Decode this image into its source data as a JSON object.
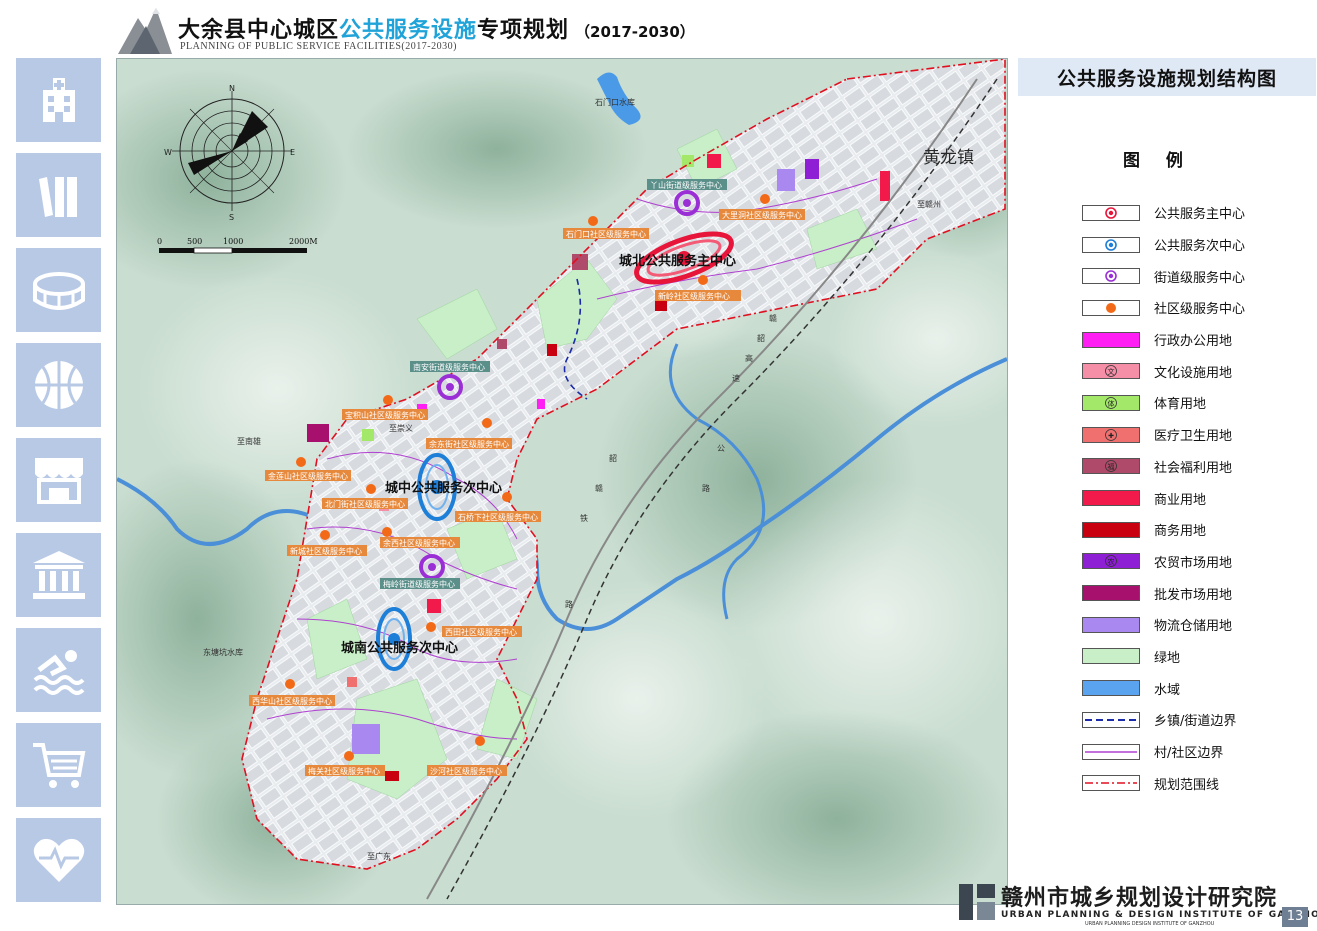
{
  "header": {
    "title_part1": "大余县中心城区",
    "title_part2": "公共服务设施",
    "title_part3": "专项规划",
    "years": "（2017-2030）",
    "subtitle": "PLANNING OF PUBLIC SERVICE FACILITIES(2017-2030)"
  },
  "sidebar": {
    "items": [
      {
        "icon": "hospital-icon"
      },
      {
        "icon": "books-icon"
      },
      {
        "icon": "stadium-icon"
      },
      {
        "icon": "basketball-icon"
      },
      {
        "icon": "shop-icon"
      },
      {
        "icon": "museum-icon"
      },
      {
        "icon": "swimming-icon"
      },
      {
        "icon": "cart-icon"
      },
      {
        "icon": "health-heart-icon"
      }
    ]
  },
  "map": {
    "compass": {
      "n": "N",
      "s": "S",
      "e": "E",
      "w": "W"
    },
    "scale": {
      "t0": "0",
      "t1": "500",
      "t2": "1000",
      "t3": "2000M"
    },
    "town_label": "黄龙镇",
    "centers": {
      "main": "城北公共服务主中心",
      "central": "城中公共服务次中心",
      "south": "城南公共服务次中心"
    },
    "labels": {
      "l1": "丫山街道级服务中心",
      "l2": "大里洞社区级服务中心",
      "l3": "石门口社区级服务中心",
      "l4": "新岭社区级服务中心",
      "l5": "南安街道级服务中心",
      "l6": "宝积山社区级服务中心",
      "l7": "余东街社区级服务中心",
      "l8": "金莲山社区级服务中心",
      "l9": "北门街社区级服务中心",
      "l10": "石桥下社区级服务中心",
      "l11": "余西社区级服务中心",
      "l12": "新城社区级服务中心",
      "l13": "梅岭街道级服务中心",
      "l14": "西田社区级服务中心",
      "l15": "西华山社区级服务中心",
      "l16": "梅关社区级服务中心",
      "l17": "沙河社区级服务中心"
    },
    "places": {
      "reservoir_n": "石门口水库",
      "reservoir_w": "东塘坑水库",
      "road_1": "至崇义",
      "road_2": "至赣州",
      "road_3": "至南雄",
      "road_4": "至广东"
    },
    "rail_chars": [
      "赣",
      "韶",
      "铁",
      "路"
    ],
    "highway_chars": [
      "赣",
      "韶",
      "高",
      "速",
      "公",
      "路"
    ]
  },
  "legend": {
    "title": "公共服务设施规划结构图",
    "heading": "图 例",
    "items": [
      {
        "label": "公共服务主中心",
        "type": "ring",
        "color": "#e8153a"
      },
      {
        "label": "公共服务次中心",
        "type": "ring",
        "color": "#1e7fd8"
      },
      {
        "label": "街道级服务中心",
        "type": "ring",
        "color": "#9b2fd6"
      },
      {
        "label": "社区级服务中心",
        "type": "dot",
        "color": "#f26a18"
      },
      {
        "label": "行政办公用地",
        "type": "fill",
        "color": "#ff1ef4"
      },
      {
        "label": "文化设施用地",
        "type": "fillsym",
        "color": "#f58fa7",
        "sym": "文"
      },
      {
        "label": "体育用地",
        "type": "fillsym",
        "color": "#a4e86a",
        "sym": "体"
      },
      {
        "label": "医疗卫生用地",
        "type": "fillsym",
        "color": "#f07070",
        "sym": "✚"
      },
      {
        "label": "社会福利用地",
        "type": "fillsym",
        "color": "#b04a6a",
        "sym": "福"
      },
      {
        "label": "商业用地",
        "type": "fill",
        "color": "#f21a4a"
      },
      {
        "label": "商务用地",
        "type": "fill",
        "color": "#c8000f"
      },
      {
        "label": "农贸市场用地",
        "type": "fillsym",
        "color": "#8f1fd4",
        "sym": "农"
      },
      {
        "label": "批发市场用地",
        "type": "fill",
        "color": "#a8106e"
      },
      {
        "label": "物流仓储用地",
        "type": "fill",
        "color": "#a988f0"
      },
      {
        "label": "绿地",
        "type": "fill",
        "color": "#c8efc8"
      },
      {
        "label": "水域",
        "type": "fill",
        "color": "#5aa3ee"
      },
      {
        "label": "乡镇/街道边界",
        "type": "dash",
        "color": "#1a2aa8"
      },
      {
        "label": "村/社区边界",
        "type": "line",
        "color": "#b040d0"
      },
      {
        "label": "规划范围线",
        "type": "dashdot",
        "color": "#e01020"
      }
    ]
  },
  "footer": {
    "institute_cn": "赣州市城乡规划设计研究院",
    "institute_en": "URBAN PLANNING & DESIGN INSTITUTE OF GANZHOU",
    "institute_en_small": "URBAN PLANNING DESIGN INSTITUTE OF GANZHOU",
    "page": "13"
  }
}
